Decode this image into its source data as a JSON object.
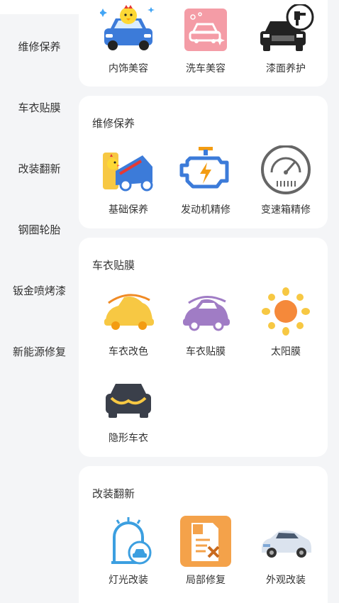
{
  "sidebar": {
    "items": [
      {
        "label": "维修保养"
      },
      {
        "label": "车衣贴膜"
      },
      {
        "label": "改装翻新"
      },
      {
        "label": "钢圈轮胎"
      },
      {
        "label": "钣金喷烤漆"
      },
      {
        "label": "新能源修复"
      }
    ]
  },
  "sections": [
    {
      "title": "",
      "items": [
        {
          "label": "内饰美容",
          "icon": "car-interior-chick-icon"
        },
        {
          "label": "洗车美容",
          "icon": "car-wash-sparkle-icon"
        },
        {
          "label": "漆面养护",
          "icon": "car-paint-spray-icon"
        }
      ]
    },
    {
      "title": "维修保养",
      "items": [
        {
          "label": "基础保养",
          "icon": "car-hood-chick-icon"
        },
        {
          "label": "发动机精修",
          "icon": "engine-icon"
        },
        {
          "label": "变速箱精修",
          "icon": "gauge-icon"
        }
      ]
    },
    {
      "title": "车衣贴膜",
      "items": [
        {
          "label": "车衣改色",
          "icon": "yellow-car-icon"
        },
        {
          "label": "车衣贴膜",
          "icon": "purple-car-icon"
        },
        {
          "label": "太阳膜",
          "icon": "sun-icon"
        },
        {
          "label": "隐形车衣",
          "icon": "car-front-icon"
        }
      ]
    },
    {
      "title": "改装翻新",
      "items": [
        {
          "label": "灯光改装",
          "icon": "car-light-icon"
        },
        {
          "label": "局部修复",
          "icon": "repair-doc-icon"
        },
        {
          "label": "外观改装",
          "icon": "sedan-icon"
        }
      ]
    }
  ],
  "colors": {
    "background": "#f4f5f7",
    "card": "#ffffff",
    "text": "#333333",
    "accent_blue": "#3c7bd9",
    "accent_yellow": "#f7c843"
  }
}
